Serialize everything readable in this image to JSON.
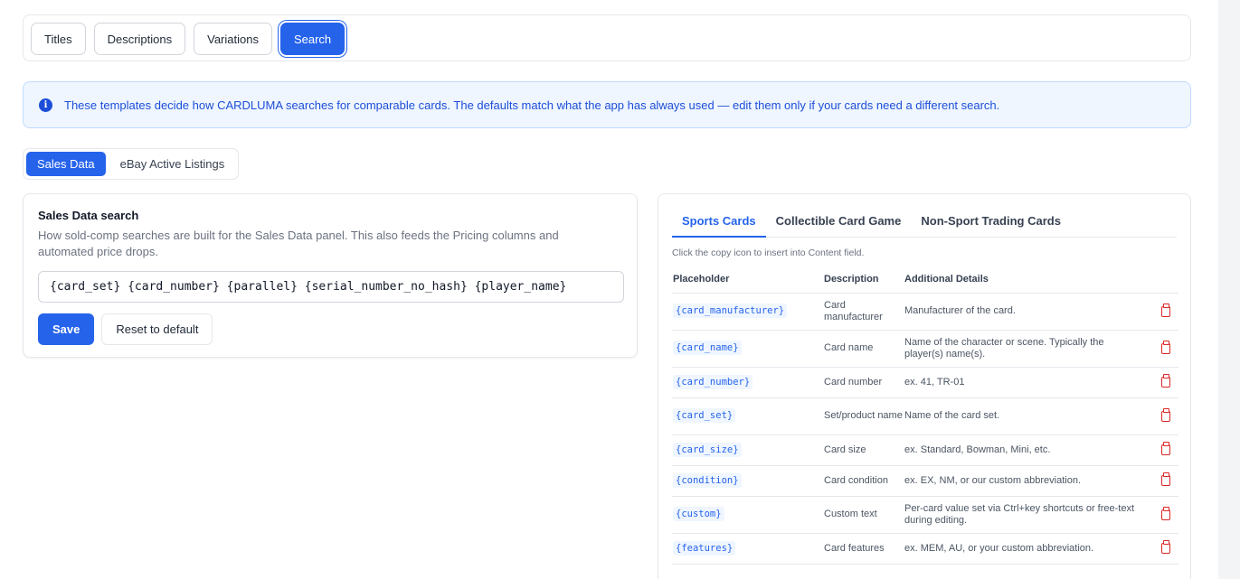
{
  "tabs": [
    "Titles",
    "Descriptions",
    "Variations",
    "Search"
  ],
  "active_tab": "Search",
  "info": {
    "text": "These templates decide how CARDLUMA searches for comparable cards. The defaults match what the app has always used — edit them only if your cards need a different search."
  },
  "subtabs": [
    "Sales Data",
    "eBay Active Listings"
  ],
  "sales": {
    "title": "Sales Data search",
    "description": "How sold-comp searches are built for the Sales Data panel. This also feeds the Pricing columns and automated price drops.",
    "template_value": "{card_set} {card_number} {parallel} {serial_number_no_hash} {player_name}",
    "save_label": "Save",
    "reset_label": "Reset to default"
  },
  "placeholders": {
    "tabs": [
      "Sports Cards",
      "Collectible Card Game",
      "Non-Sport Trading Cards"
    ],
    "hint": "Click the copy icon to insert into Content field.",
    "headers": [
      "Placeholder",
      "Description",
      "Additional Details"
    ],
    "rows": [
      {
        "code": "{card_manufacturer}",
        "desc": "Card manufacturer",
        "details": "Manufacturer of the card."
      },
      {
        "code": "{card_name}",
        "desc": "Card name",
        "details": "Name of the character or scene. Typically the player(s) name(s)."
      },
      {
        "code": "{card_number}",
        "desc": "Card number",
        "details": "ex. 41, TR-01"
      },
      {
        "code": "{card_set}",
        "desc": "Set/product name",
        "details": "Name of the card set."
      },
      {
        "code": "{card_size}",
        "desc": "Card size",
        "details": "ex. Standard, Bowman, Mini, etc."
      },
      {
        "code": "{condition}",
        "desc": "Card condition",
        "details": "ex. EX, NM, or our custom abbreviation."
      },
      {
        "code": "{custom}",
        "desc": "Custom text",
        "details": "Per-card value set via Ctrl+key shortcuts or free-text during editing."
      },
      {
        "code": "{features}",
        "desc": "Card features",
        "details": "ex. MEM, AU, or your custom abbreviation."
      }
    ]
  },
  "icons": {
    "info": "info-icon",
    "copy": "clipboard-icon"
  }
}
